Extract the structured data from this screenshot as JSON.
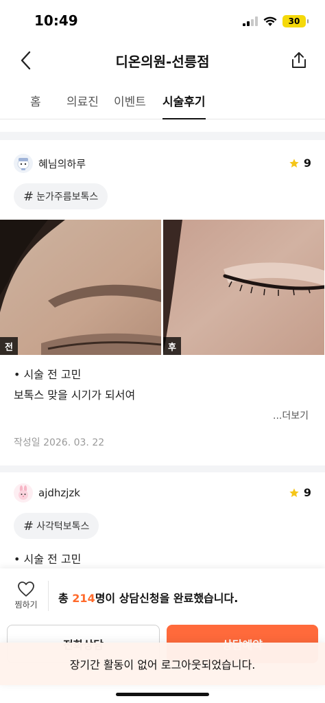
{
  "status_bar": {
    "time": "10:49",
    "battery": "30"
  },
  "header": {
    "title": "디온의원-선릉점"
  },
  "tabs": [
    {
      "label": "홈",
      "active": false
    },
    {
      "label": "의료진",
      "active": false
    },
    {
      "label": "이벤트",
      "active": false
    },
    {
      "label": "시술후기",
      "active": true
    }
  ],
  "reviews": [
    {
      "username": "혜님의하루",
      "rating": "9",
      "tag": "눈가주름보톡스",
      "photo_before_label": "전",
      "photo_after_label": "후",
      "line1": "• 시술 전 고민",
      "line2": "보톡스 맞을 시기가 되서여",
      "more": "...더보기",
      "date": "작성일 2026. 03. 22"
    },
    {
      "username": "ajdhzjzk",
      "rating": "9",
      "tag": "사각턱보톡스",
      "line1": "• 시술 전 고민"
    }
  ],
  "bottom": {
    "wish_label": "찜하기",
    "consult_prefix": "총 ",
    "consult_count": "214",
    "consult_suffix": "명이 상담신청을 완료했습니다.",
    "left_button": "전화상담",
    "right_button": "상담예약"
  },
  "toast": "장기간 활동이 없어 로그아웃되었습니다.",
  "colors": {
    "accent": "#ff6a3b",
    "star": "#f5c518"
  }
}
